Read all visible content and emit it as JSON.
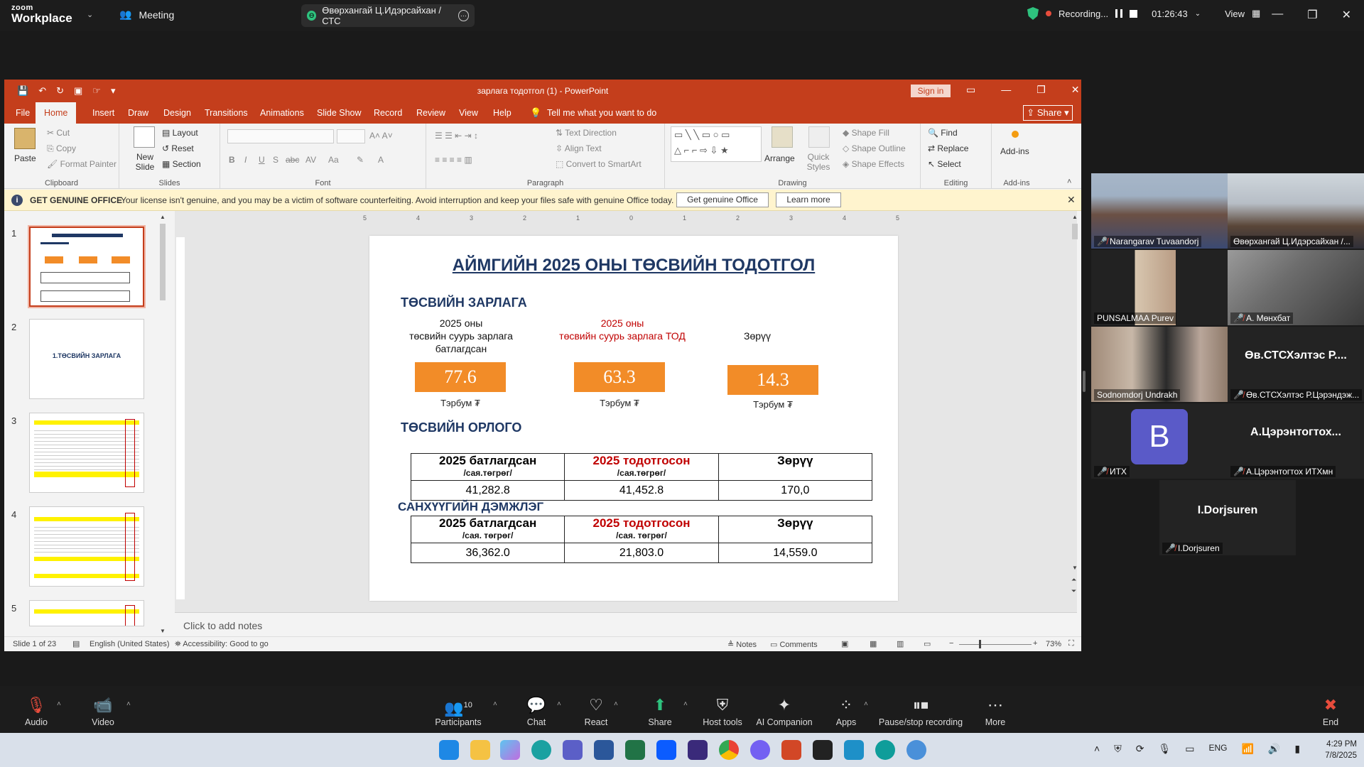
{
  "zoom": {
    "logo_top": "zoom",
    "logo_bottom": "Workplace",
    "meeting_label": "Meeting",
    "share_tab_label": "Өвөрхангай Ц.Идэрсайхан /СТС",
    "recording_label": "Recording...",
    "timer": "01:26:43",
    "view_label": "View"
  },
  "ppt": {
    "window_title": "зарлага тодотгол (1)  -  PowerPoint",
    "sign_in": "Sign in",
    "share": "Share",
    "tabs": [
      "File",
      "Home",
      "Insert",
      "Draw",
      "Design",
      "Transitions",
      "Animations",
      "Slide Show",
      "Record",
      "Review",
      "View",
      "Help"
    ],
    "tell_me": "Tell me what you want to do",
    "ribbon": {
      "paste": "Paste",
      "cut": "Cut",
      "copy": "Copy",
      "format_painter": "Format Painter",
      "clipboard": "Clipboard",
      "new_slide": "New Slide",
      "layout": "Layout",
      "reset": "Reset",
      "section": "Section",
      "slides": "Slides",
      "font": "Font",
      "text_direction": "Text Direction",
      "align_text": "Align Text",
      "convert_smartart": "Convert to SmartArt",
      "paragraph": "Paragraph",
      "arrange": "Arrange",
      "quick_styles": "Quick Styles",
      "shape_fill": "Shape Fill",
      "shape_outline": "Shape Outline",
      "shape_effects": "Shape Effects",
      "drawing": "Drawing",
      "find": "Find",
      "replace": "Replace",
      "select": "Select",
      "editing": "Editing",
      "addins": "Add-ins",
      "addins_group": "Add-ins"
    },
    "genuine": {
      "title": "GET GENUINE OFFICE",
      "message": "Your license isn't genuine, and you may be a victim of software counterfeiting. Avoid interruption and keep your files safe with genuine Office today.",
      "get_button": "Get genuine Office",
      "learn_button": "Learn more"
    },
    "thumbnail_numbers": [
      "1",
      "2",
      "3",
      "4",
      "5"
    ],
    "thumb2_text": "1.ТӨСВИЙН ЗАРЛАГА",
    "notes_placeholder": "Click to add notes",
    "status": {
      "slide": "Slide 1 of 23",
      "language": "English (United States)",
      "accessibility": "Accessibility: Good to go",
      "notes": "Notes",
      "comments": "Comments",
      "zoom": "73%"
    },
    "ruler_marks": [
      "5",
      "4",
      "3",
      "2",
      "1",
      "0",
      "1",
      "2",
      "3",
      "4",
      "5"
    ]
  },
  "slide": {
    "title": "АЙМГИЙН 2025 ОНЫ ТӨСВИЙН ТОДОТГОЛ",
    "section1": "ТӨСВИЙН ЗАРЛАГА",
    "col1_caption": "2025 оны\nтөсвийн суурь зарлага\nбатлагдсан",
    "col2_caption": "2025 оны\nтөсвийн суурь зарлага ТОД",
    "col3_caption": "Зөрүү",
    "val1": "77.6",
    "val2": "63.3",
    "val3": "14.3",
    "unit": "Тэрбум ₮",
    "section2": "ТӨСВИЙН ОРЛОГО",
    "t1": {
      "h1": "2025 батлагдсан",
      "s1": "/сая.төгрөг/",
      "h2": "2025 тодотгосон",
      "s2": "/сая.төгрөг/",
      "h3": "Зөрүү",
      "v1": "41,282.8",
      "v2": "41,452.8",
      "v3": "170,0"
    },
    "section3": "САНХҮҮГИЙН ДЭМЖЛЭГ",
    "t2": {
      "h1": "2025 батлагдсан",
      "s1": "/сая. төгрөг/",
      "h2": "2025 тодотгосон",
      "s2": "/сая. төгрөг/",
      "h3": "Зөрүү",
      "v1": "36,362.0",
      "v2": "21,803.0",
      "v3": "14,559.0"
    }
  },
  "participants": [
    {
      "name": "Narangarav Tuvaandorj",
      "muted": true
    },
    {
      "name": "Өвөрхангай Ц.Идэрсайхан /...",
      "muted": false
    },
    {
      "name": "PUNSALMAA Purev",
      "muted": false
    },
    {
      "name": "А. Мөнхбат",
      "muted": true
    },
    {
      "name": "Sodnomdorj Undrakh",
      "muted": false
    },
    {
      "name": "Өв.СТСХэлтэс Р.Цэрэндэж...",
      "muted": true,
      "big": "Өв.СТСХэлтэс  Р...."
    },
    {
      "name": "ИТХ",
      "muted": true,
      "avatar": "B"
    },
    {
      "name": "А.Цэрэнтогтох ИТХмн",
      "muted": true,
      "big": "А.Цэрэнтогтох..."
    },
    {
      "name": "I.Dorjsuren",
      "muted": true,
      "big": "I.Dorjsuren"
    }
  ],
  "toolbar": {
    "audio": "Audio",
    "video": "Video",
    "participants": "Participants",
    "participants_count": "10",
    "chat": "Chat",
    "react": "React",
    "share": "Share",
    "host_tools": "Host tools",
    "ai_companion": "AI Companion",
    "apps": "Apps",
    "pause_stop": "Pause/stop recording",
    "more": "More",
    "end": "End"
  },
  "taskbar": {
    "lang": "ENG",
    "time": "4:29 PM",
    "date": "7/8/2025"
  },
  "colors": {
    "ppt_accent": "#c43e1c",
    "slide_orange": "#f28c28",
    "slide_navy": "#1f3864",
    "slide_red": "#c00000",
    "zoom_green": "#2ec27e"
  }
}
